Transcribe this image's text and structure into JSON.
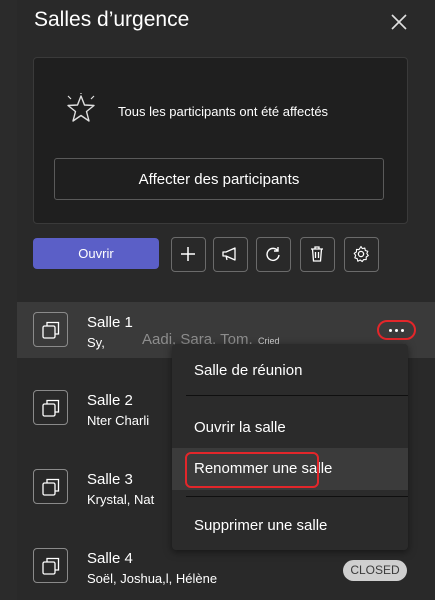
{
  "header": {
    "title": "Salles d’urgence",
    "close_icon": "close-icon"
  },
  "assignment": {
    "icon": "star-icon",
    "message": "Tous les participants ont été affectés",
    "button_label": "Affecter des participants"
  },
  "toolbar": {
    "open_label": "Ouvrir",
    "tools": [
      "plus-icon",
      "announcement-icon",
      "refresh-icon",
      "delete-icon",
      "settings-icon"
    ]
  },
  "rooms": [
    {
      "name": "Salle 1",
      "members": "Sy,",
      "faded_members": "Aadi, Sara, Tom,",
      "faded_extra": "Cried"
    },
    {
      "name": "Salle 2",
      "members": "Nter Charli"
    },
    {
      "name": "Salle 3",
      "members": "Krystal, Nat"
    },
    {
      "name": "Salle 4",
      "members": "Soël, Joshua,l, Hélène",
      "status": "CLOSED"
    }
  ],
  "context_menu": {
    "items": [
      {
        "label": "Salle de réunion"
      },
      {
        "label": "Ouvrir la salle"
      },
      {
        "label": "Renommer une salle"
      },
      {
        "label": "Supprimer une salle"
      }
    ]
  },
  "colors": {
    "accent": "#5b5fc7",
    "highlight_outline": "#e3262a",
    "background": "#1f1f1f",
    "panel": "#292929"
  }
}
